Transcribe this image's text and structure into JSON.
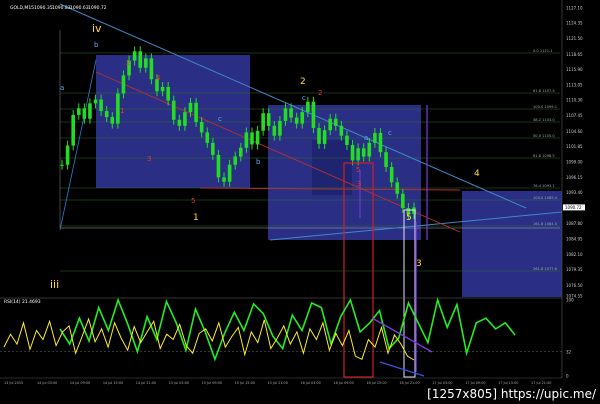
{
  "header": {
    "symbol_title": "GOLD,M15",
    "ohlc": [
      "1090.35",
      "1090.83",
      "1090.63",
      "1090.72"
    ]
  },
  "rsi_header": {
    "title": "RSI(14) 21.4693"
  },
  "watermark": "[1257x805] https://upic.me/",
  "chart_data": {
    "type": "line",
    "title": "GOLD,M15",
    "price_axis_ticks": [
      "1127.10",
      "1124.35",
      "1121.50",
      "1118.65",
      "1115.90",
      "1113.05",
      "1110.30",
      "1107.45",
      "1104.60",
      "1101.85",
      "1099.00",
      "1096.15",
      "1093.40",
      "1090.55",
      "1087.80",
      "1084.95",
      "1082.10",
      "1079.35",
      "1076.50",
      "1074.55"
    ],
    "current_price": "1090.72",
    "rsi_axis_ticks": [
      "100",
      "32",
      "0"
    ],
    "fib_labels": [
      "0.0 1121.1",
      "61.8 1107.5",
      "100.0 1099.1",
      "38.2 1103.0",
      "50.0 1105.0",
      "61.8 1098.5",
      "76.4 1093.1",
      "100.0 1089.4",
      "161.8 1084.0",
      "261.8 1077.6"
    ],
    "wave_labels": {
      "yellow": [
        "iv",
        "iii",
        "1",
        "2",
        "3",
        "4",
        "5"
      ],
      "blue": [
        "a",
        "b",
        "c",
        "c",
        "a",
        "c",
        "b"
      ],
      "red": [
        "2",
        "4",
        "1",
        "3",
        "5",
        "2",
        "5",
        "3"
      ]
    },
    "price_series": [
      1098.5,
      1102.0,
      1107.6,
      1108.8,
      1106.9,
      1109.7,
      1110.4,
      1108.3,
      1107.2,
      1106.0,
      1111.5,
      1114.8,
      1117.5,
      1119.2,
      1116.2,
      1117.9,
      1114.1,
      1111.9,
      1112.7,
      1110.2,
      1106.7,
      1105.6,
      1108.1,
      1109.8,
      1106.3,
      1104.4,
      1102.5,
      1100.3,
      1096.2,
      1095.4,
      1098.5,
      1100.0,
      1101.6,
      1104.4,
      1102.2,
      1104.7,
      1107.9,
      1105.6,
      1103.8,
      1106.5,
      1108.8,
      1107.1,
      1106.0,
      1108.1,
      1110.0,
      1105.2,
      1102.3,
      1104.8,
      1106.9,
      1105.6,
      1103.8,
      1102.1,
      1099.3,
      1101.5,
      1100.0,
      1102.5,
      1104.3,
      1100.8,
      1098.1,
      1095.3,
      1093.2,
      1090.6,
      1089.5,
      1090.7
    ],
    "rsi_series": [
      38,
      55,
      42,
      70,
      35,
      60,
      48,
      72,
      40,
      58,
      66,
      30,
      52,
      75,
      45,
      62,
      38,
      70,
      50,
      34,
      65,
      44,
      58,
      72,
      36,
      55,
      48,
      68,
      40,
      30,
      56,
      62,
      46,
      70,
      38,
      52,
      64,
      28,
      58,
      44,
      74,
      36,
      50,
      66,
      42,
      58,
      30,
      62,
      48,
      70,
      34,
      56,
      40,
      60,
      26,
      22,
      48,
      38,
      64,
      30,
      54,
      42,
      26,
      21
    ],
    "rsi_zigzag": [
      62,
      42,
      76,
      46,
      90,
      60,
      100,
      68,
      32,
      78,
      48,
      98,
      70,
      34,
      88,
      58,
      22,
      56,
      84,
      60,
      95,
      82,
      52,
      36,
      80,
      60,
      96,
      90,
      42,
      78,
      100,
      58,
      70,
      86,
      36,
      50,
      96,
      70,
      44,
      100,
      64,
      94,
      30,
      70,
      76,
      62,
      70,
      54
    ],
    "time_axis_ticks": [
      "13 Jul 2015",
      "14 Jul 03:00",
      "14 Jul 09:00",
      "14 Jul 15:00",
      "14 Jul 21:00",
      "15 Jul 03:00",
      "15 Jul 09:00",
      "15 Jul 15:00",
      "15 Jul 21:00",
      "16 Jul 03:00",
      "16 Jul 09:00",
      "16 Jul 15:00",
      "16 Jul 21:00",
      "17 Jul 03:00",
      "17 Jul 09:00",
      "17 Jul 15:00",
      "17 Jul 21:00"
    ],
    "colors": {
      "background": "#000000",
      "candle": "#22dd22",
      "rectangle": "#2a2f85",
      "rsi": "#ffee22",
      "zigzag": "#22ee22",
      "trend_blue": "#3e88c8",
      "trend_red": "#b83030",
      "box_red": "#cc2222",
      "box_white": "#e0e0ff",
      "projection": "#7a39d8"
    }
  }
}
